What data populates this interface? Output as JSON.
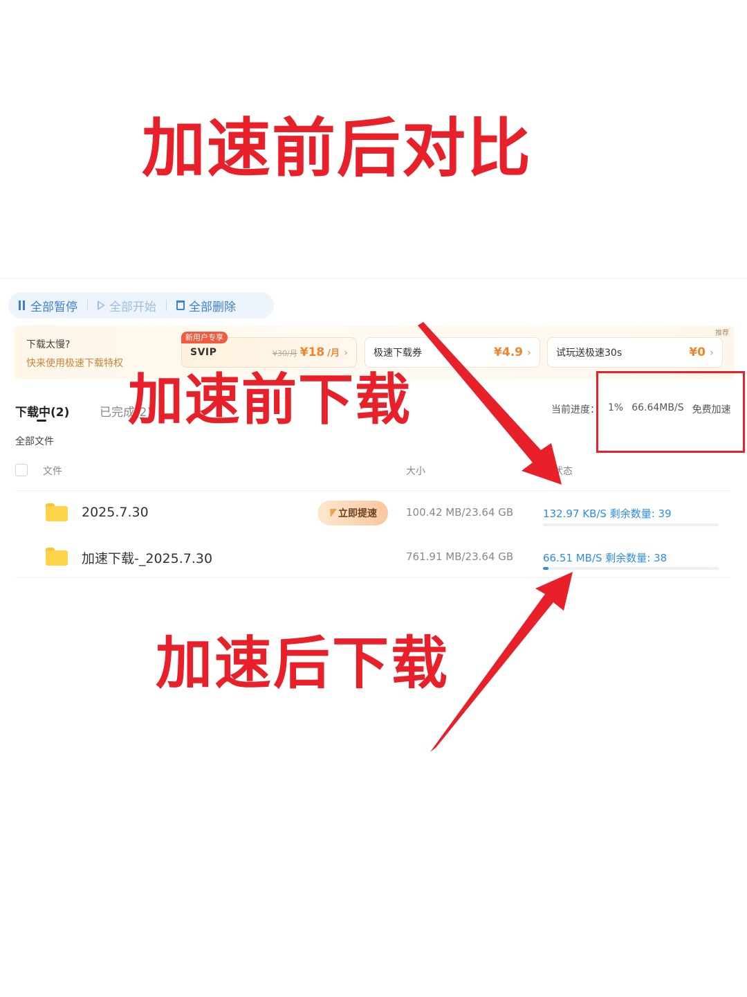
{
  "heading": "加速前后对比",
  "toolbar": {
    "pause_all": "全部暂停",
    "start_all": "全部开始",
    "delete_all": "全部删除"
  },
  "promo": {
    "question": "下载太慢?",
    "subtitle": "快来使用极速下载特权",
    "tag": "推荐",
    "cards": [
      {
        "badge": "新用户专享",
        "name": "SVIP",
        "orig_price": "¥30/月",
        "price": "¥18",
        "unit": "/月"
      },
      {
        "name": "极速下载券",
        "price": "¥4.9"
      },
      {
        "name": "试玩送极速30s",
        "price": "¥0"
      }
    ]
  },
  "tabs": {
    "downloading": "下载中(2)",
    "completed": "已完成(2)"
  },
  "breadcrumb": "全部文件",
  "progress": {
    "label": "当前进度：",
    "percent": "1%",
    "speed": "66.64MB/S",
    "free_boost": "免费加速"
  },
  "table": {
    "headers": {
      "file": "文件",
      "size": "大小",
      "status": "状态"
    },
    "rows": [
      {
        "name": "2025.7.30",
        "size": "100.42 MB/23.64 GB",
        "status": "132.97 KB/S 剩余数量: 39",
        "progress": 0.0,
        "boost_label": "立即提速"
      },
      {
        "name": "加速下载-_2025.7.30",
        "size": "761.91 MB/23.64 GB",
        "status": "66.51 MB/S 剩余数量: 38",
        "progress": 0.03
      }
    ]
  },
  "annotations": {
    "before": "加速前下载",
    "after": "加速后下载"
  },
  "colors": {
    "annotation_red": "#e8202a",
    "accent_blue": "#2d8ce6",
    "promo_orange": "#f0842c"
  }
}
